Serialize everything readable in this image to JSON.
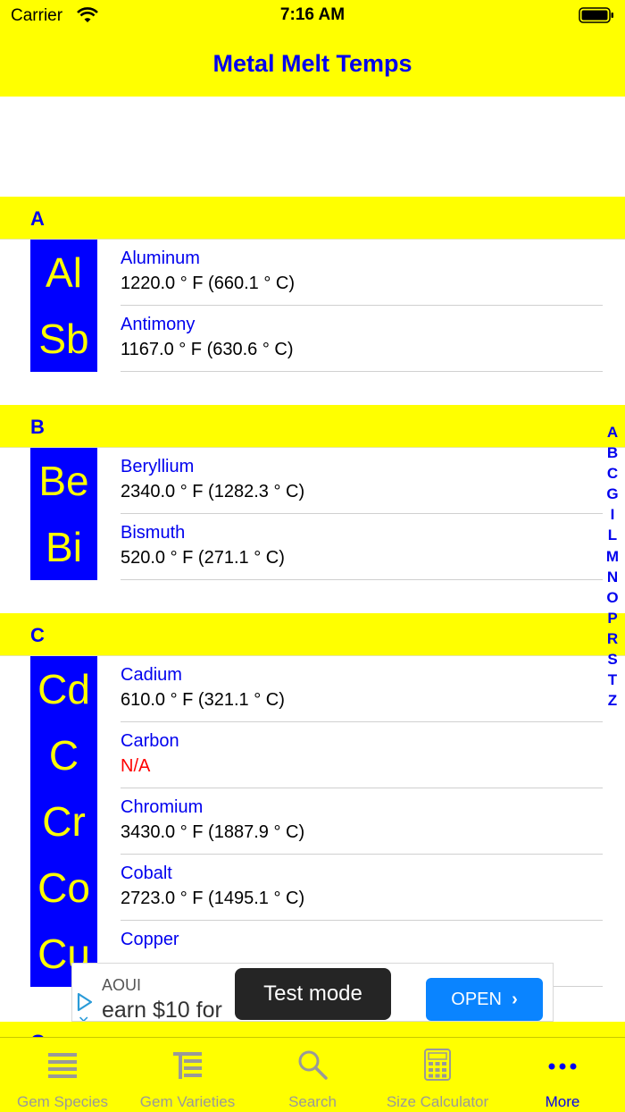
{
  "status_bar": {
    "carrier": "Carrier",
    "time": "7:16 AM"
  },
  "nav": {
    "title": "Metal Melt Temps"
  },
  "sections": [
    {
      "letter": "A",
      "items": [
        {
          "symbol": "Al",
          "name": "Aluminum",
          "temp": "1220.0 ° F (660.1 ° C)"
        },
        {
          "symbol": "Sb",
          "name": "Antimony",
          "temp": "1167.0 ° F (630.6 ° C)"
        }
      ]
    },
    {
      "letter": "B",
      "items": [
        {
          "symbol": "Be",
          "name": "Beryllium",
          "temp": "2340.0 ° F (1282.3 ° C)"
        },
        {
          "symbol": "Bi",
          "name": "Bismuth",
          "temp": "520.0 ° F (271.1 ° C)"
        }
      ]
    },
    {
      "letter": "C",
      "items": [
        {
          "symbol": "Cd",
          "name": "Cadium",
          "temp": "610.0 ° F (321.1 ° C)"
        },
        {
          "symbol": "C",
          "name": "Carbon",
          "temp": "N/A"
        },
        {
          "symbol": "Cr",
          "name": "Chromium",
          "temp": "3430.0 ° F (1887.9 ° C)"
        },
        {
          "symbol": "Co",
          "name": "Cobalt",
          "temp": "2723.0 ° F (1495.1 ° C)"
        },
        {
          "symbol": "Cu",
          "name": "Copper",
          "temp": ""
        }
      ]
    },
    {
      "letter": "G",
      "items": []
    }
  ],
  "index": [
    "A",
    "B",
    "C",
    "G",
    "I",
    "L",
    "M",
    "N",
    "O",
    "P",
    "R",
    "S",
    "T",
    "Z"
  ],
  "ad": {
    "brand": "AOUI",
    "headline": "earn $10 for",
    "cta": "OPEN"
  },
  "test_mode": "Test mode",
  "tabs": [
    {
      "label": "Gem Species",
      "icon": "list-icon"
    },
    {
      "label": "Gem Varieties",
      "icon": "list-detail-icon"
    },
    {
      "label": "Search",
      "icon": "search-icon"
    },
    {
      "label": "Size Calculator",
      "icon": "calculator-icon"
    },
    {
      "label": "More",
      "icon": "more-icon",
      "active": true
    }
  ],
  "colors": {
    "bar": "#ffff00",
    "accent": "#0000ee",
    "symbol_bg": "#0000ff",
    "symbol_text": "#ffff00",
    "na": "#ff0000"
  }
}
